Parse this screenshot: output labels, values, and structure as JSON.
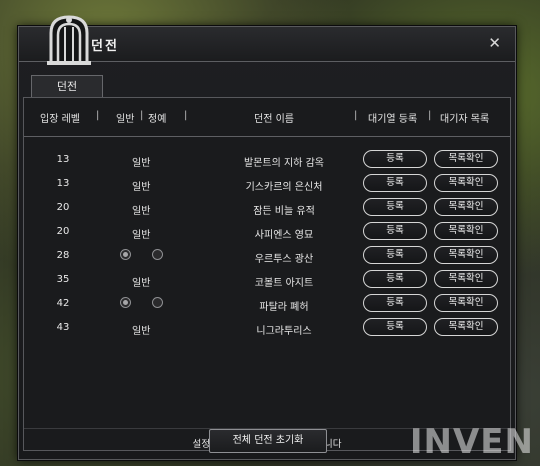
{
  "window": {
    "title": "던전"
  },
  "tab": {
    "label": "던전"
  },
  "columns": {
    "level": "입장 레벨",
    "normal": "일반",
    "elite": "정예",
    "name": "던전 이름",
    "queue": "대기열 등록",
    "waitlist": "대기자 목록"
  },
  "rows": [
    {
      "level": "13",
      "difficulty": "일반",
      "name": "발몬트의 지하 감옥",
      "register": "등록",
      "list": "목록확인"
    },
    {
      "level": "13",
      "difficulty": "일반",
      "name": "기스카르의 은신처",
      "register": "등록",
      "list": "목록확인"
    },
    {
      "level": "20",
      "difficulty": "일반",
      "name": "잠든 비늘 유적",
      "register": "등록",
      "list": "목록확인"
    },
    {
      "level": "20",
      "difficulty": "일반",
      "name": "사피엔스 영묘",
      "register": "등록",
      "list": "목록확인"
    },
    {
      "level": "28",
      "difficulty": "",
      "name": "우르투스 광산",
      "register": "등록",
      "list": "목록확인"
    },
    {
      "level": "35",
      "difficulty": "일반",
      "name": "코볼트 아지트",
      "register": "등록",
      "list": "목록확인"
    },
    {
      "level": "42",
      "difficulty": "",
      "name": "파탈라 폐허",
      "register": "등록",
      "list": "목록확인"
    },
    {
      "level": "43",
      "difficulty": "일반",
      "name": "니그라투리스",
      "register": "등록",
      "list": "목록확인"
    }
  ],
  "footer": {
    "notice": "설정한 난이도의 던전으로 입장됩니다",
    "reset_label": "전체 던전 초기화"
  },
  "watermark": "INVEN",
  "icons": {
    "close": "close-icon",
    "emblem": "gate-emblem-icon"
  }
}
